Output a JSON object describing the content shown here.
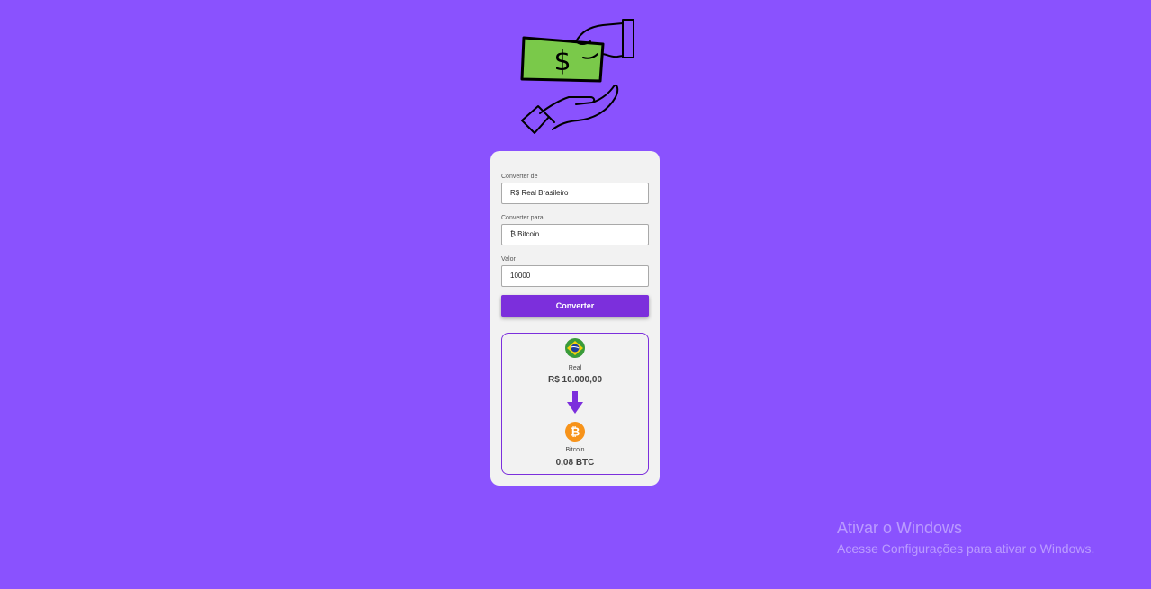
{
  "colors": {
    "background": "#8a52fe",
    "accent": "#7c2fdc",
    "card": "#f2f2f2",
    "bill": "#7ac94a"
  },
  "hero": {
    "icon": "money-exchange-icon",
    "bill_symbol": "$"
  },
  "form": {
    "from": {
      "label": "Converter de",
      "value": "R$ Real Brasileiro"
    },
    "to": {
      "label": "Converter para",
      "value": "₿ Bitcoin"
    },
    "amount": {
      "label": "Valor",
      "value": "10000"
    },
    "submit_label": "Converter"
  },
  "result": {
    "from": {
      "icon": "brazil-flag-icon",
      "name": "Real",
      "value": "R$ 10.000,00"
    },
    "arrow_icon": "arrow-down-icon",
    "to": {
      "icon": "bitcoin-icon",
      "name": "Bitcoin",
      "value": "0,08 BTC"
    }
  },
  "watermark": {
    "title": "Ativar o Windows",
    "subtitle": "Acesse Configurações para ativar o Windows."
  }
}
